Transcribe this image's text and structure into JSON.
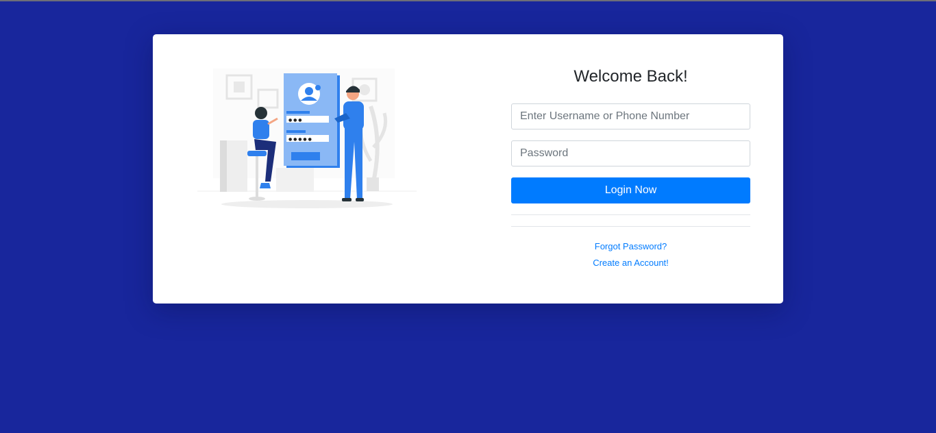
{
  "login": {
    "title": "Welcome Back!",
    "username_placeholder": "Enter Username or Phone Number",
    "username_value": "",
    "password_placeholder": "Password",
    "password_value": "",
    "login_button": "Login Now",
    "forgot_link": "Forgot Password?",
    "create_link": "Create an Account!"
  },
  "illustration": {
    "name": "login-illustration",
    "password_dots_1": "● ● ●",
    "password_dots_2": "● ● ● ● ●"
  },
  "colors": {
    "background": "#18269c",
    "card": "#ffffff",
    "primary": "#007bff",
    "illustration_blue": "#2f80ed",
    "illustration_light": "#8ab8f5"
  }
}
